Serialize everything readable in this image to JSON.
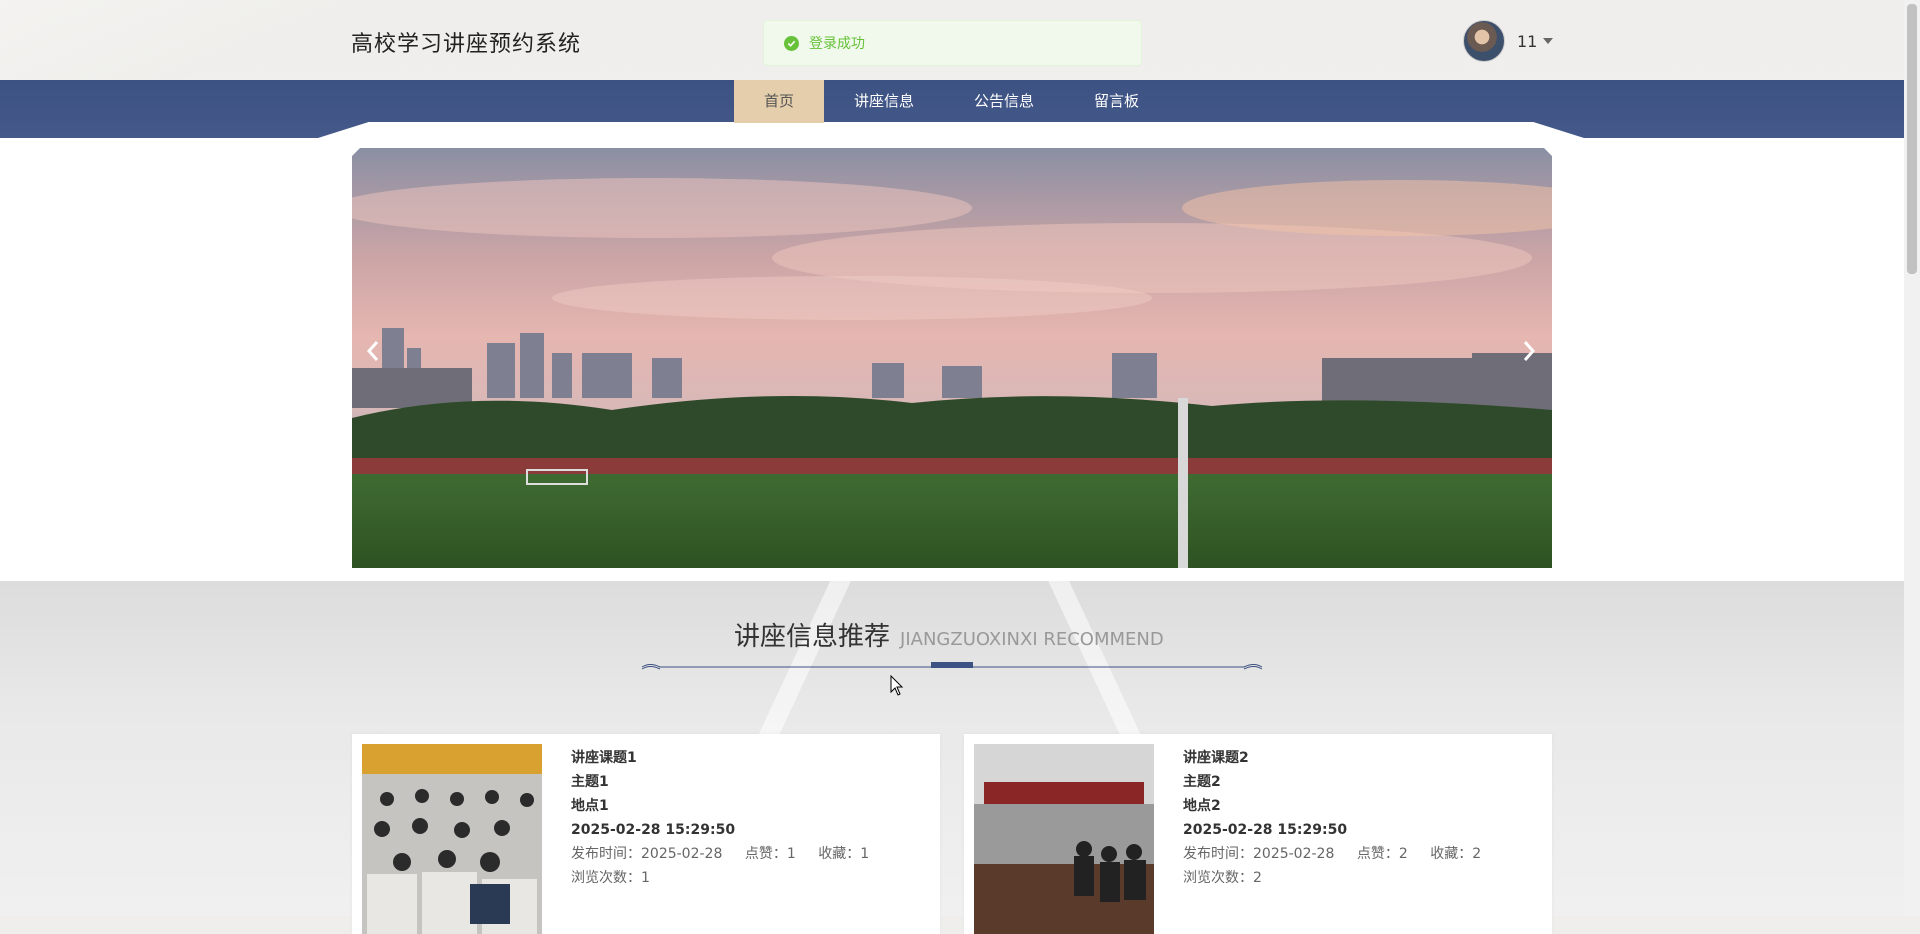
{
  "header": {
    "site_title": "高校学习讲座预约系统",
    "toast": "登录成功",
    "username": "11"
  },
  "nav": {
    "items": [
      {
        "label": "首页",
        "active": true
      },
      {
        "label": "讲座信息",
        "active": false
      },
      {
        "label": "公告信息",
        "active": false
      },
      {
        "label": "留言板",
        "active": false
      }
    ]
  },
  "section": {
    "title": "讲座信息推荐",
    "subtitle": "JIANGZUOXINXI RECOMMEND"
  },
  "cards": [
    {
      "title": "讲座课题1",
      "topic": "主题1",
      "location": "地点1",
      "time": "2025-02-28 15:29:50",
      "publish_label": "发布时间：2025-02-28",
      "likes_label": "点赞：1",
      "favorites_label": "收藏：1",
      "views_label": "浏览次数：1"
    },
    {
      "title": "讲座课题2",
      "topic": "主题2",
      "location": "地点2",
      "time": "2025-02-28 15:29:50",
      "publish_label": "发布时间：2025-02-28",
      "likes_label": "点赞：2",
      "favorites_label": "收藏：2",
      "views_label": "浏览次数：2"
    }
  ],
  "icons": {
    "toast": "check-circle-icon",
    "prev": "chevron-left-icon",
    "next": "chevron-right-icon",
    "user_menu": "caret-down-icon"
  },
  "colors": {
    "nav_bg": "#3c5282",
    "nav_active_bg": "#e5ceab",
    "success": "#67c23a"
  }
}
